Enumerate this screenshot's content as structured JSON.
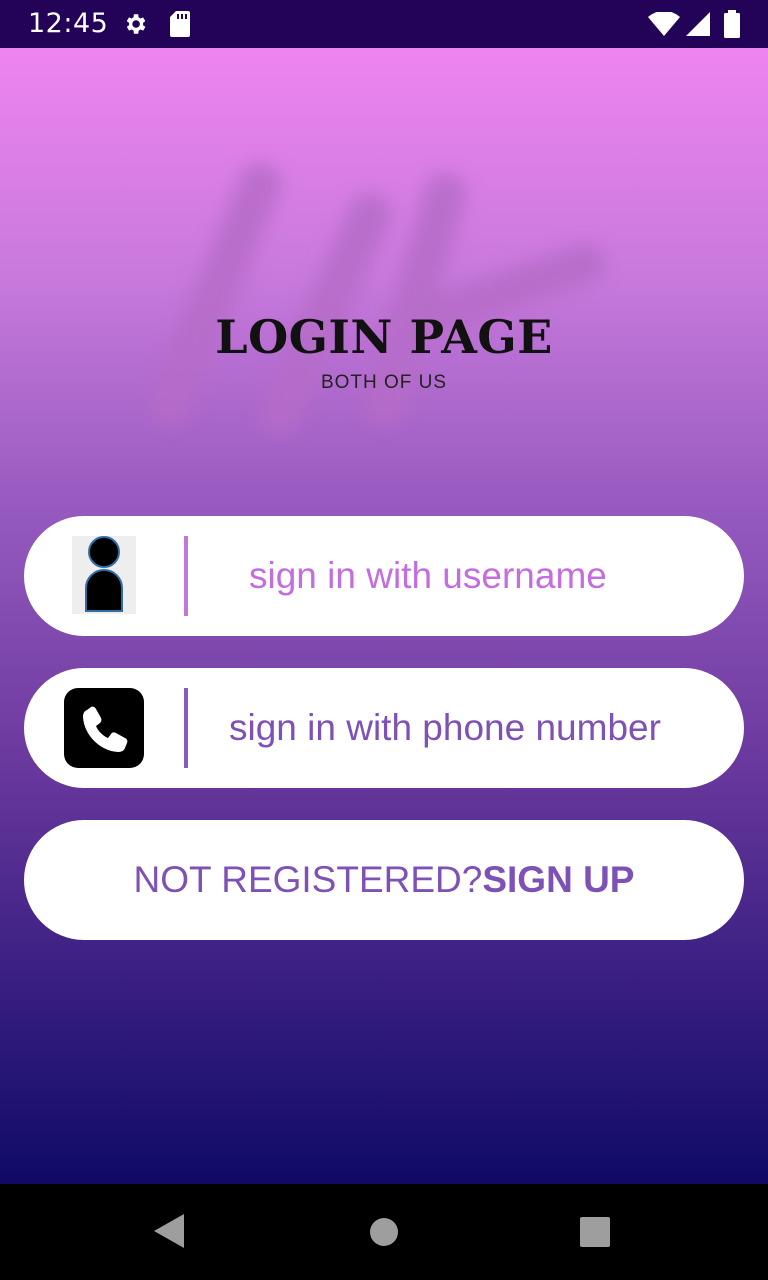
{
  "status_bar": {
    "time": "12:45",
    "icons": [
      "gear-icon",
      "sd-card-icon",
      "wifi-icon",
      "signal-icon",
      "battery-icon"
    ]
  },
  "logo": {
    "title": "LOGIN PAGE",
    "subtitle": "BOTH OF US"
  },
  "options": {
    "username": {
      "label": "sign in with username",
      "icon": "person-icon"
    },
    "phone": {
      "label": "sign in with phone number",
      "icon": "phone-icon"
    }
  },
  "signup": {
    "prefix": "NOT REGISTERED?",
    "action": "SIGN UP"
  },
  "nav_bar": {
    "icons": [
      "back-icon",
      "home-icon",
      "recents-icon"
    ]
  },
  "colors": {
    "status_bar": "#230357",
    "gradient_top": "#ee84f0",
    "gradient_bottom": "#0f0a66",
    "username_accent": "#c46ddf",
    "phone_accent": "#7e51b7"
  }
}
